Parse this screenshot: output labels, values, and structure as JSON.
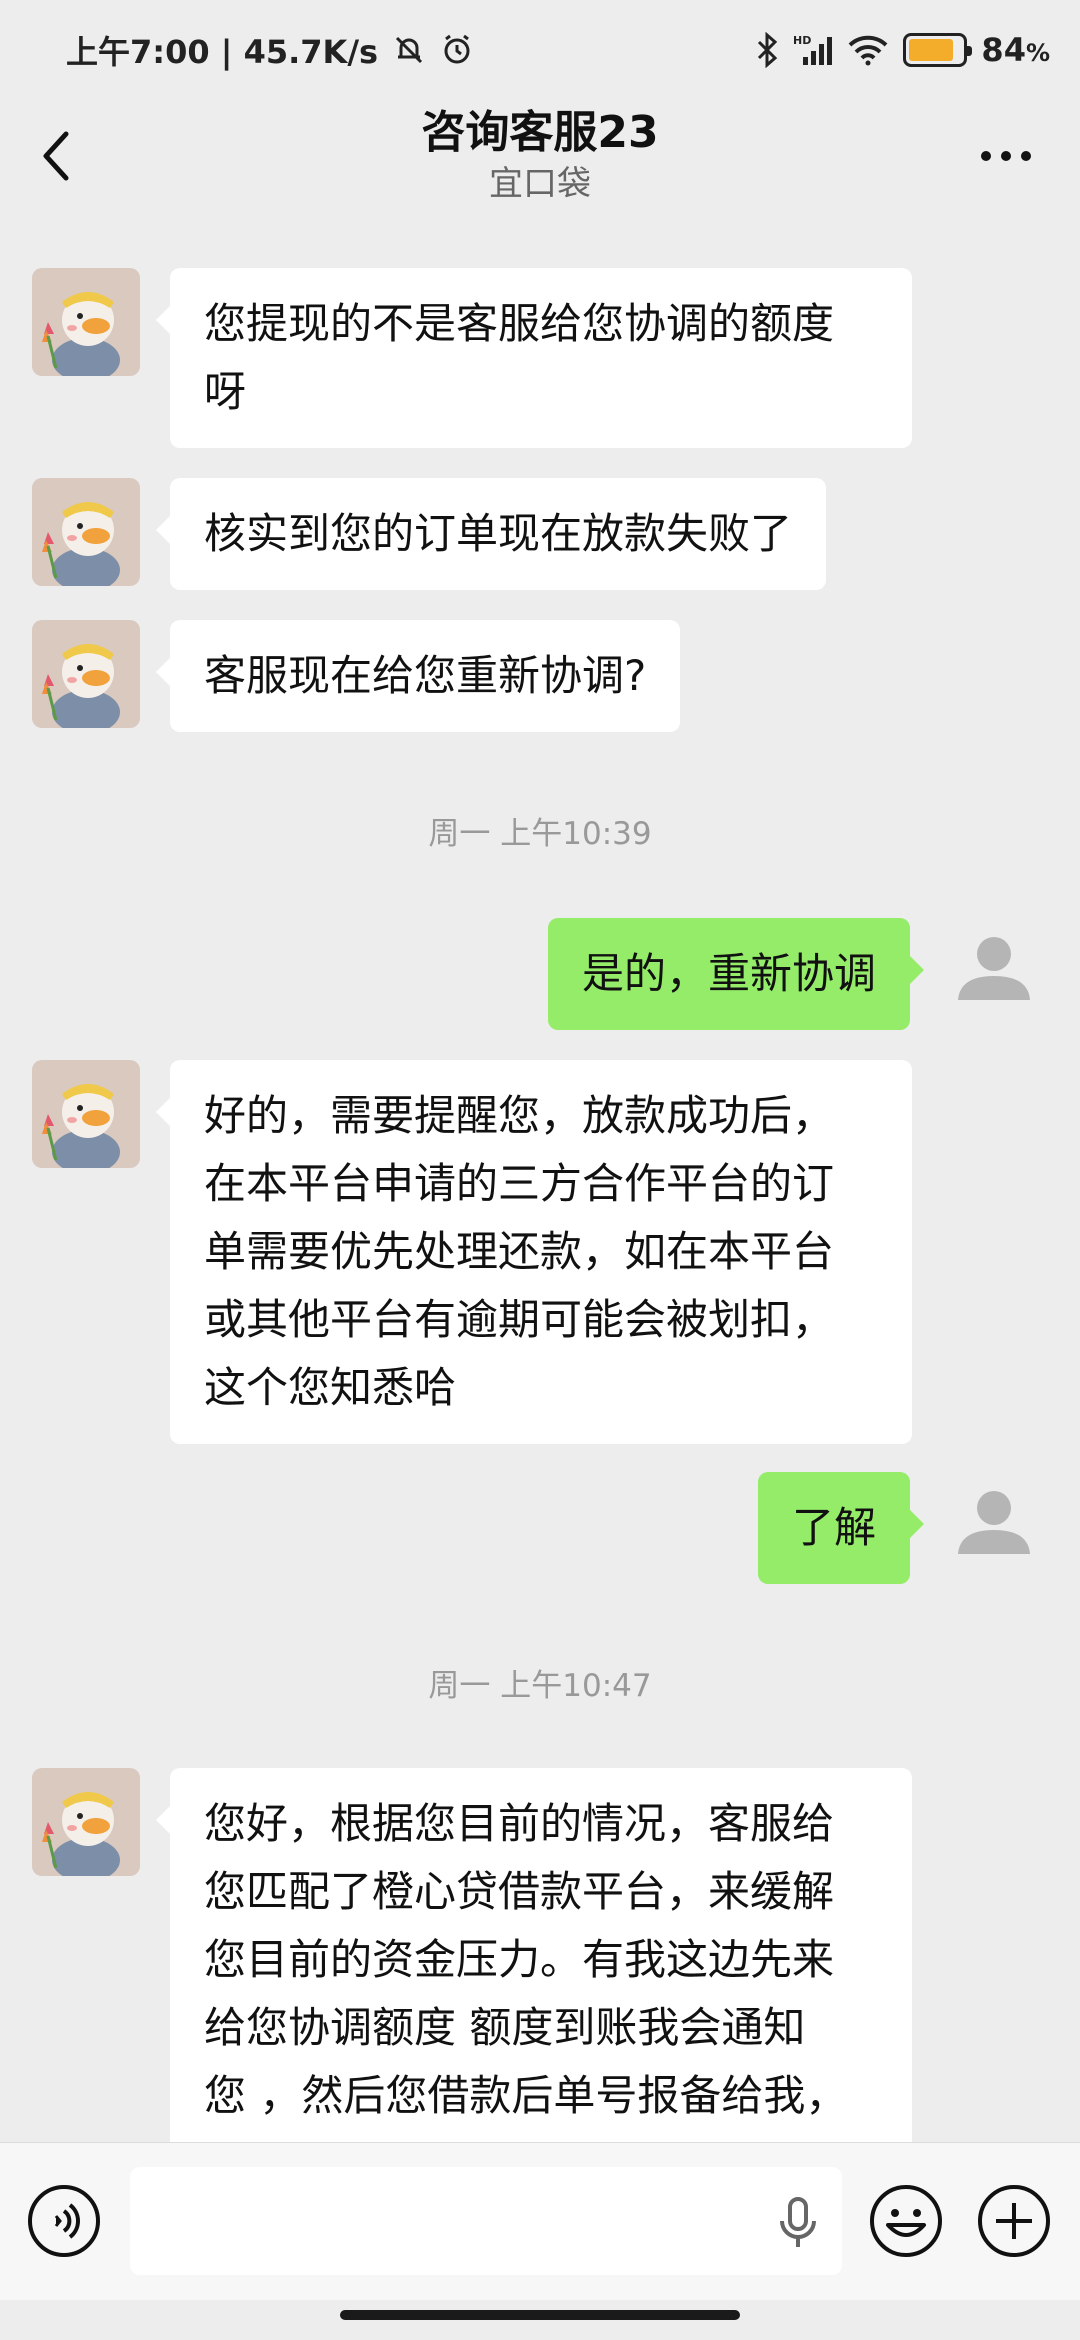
{
  "status_bar": {
    "time": "上午7:00 | 45.7K/s",
    "battery_percent": "84",
    "battery_unit": "%",
    "battery_level": 0.84,
    "battery_color": "#f3ad2a",
    "icons": [
      "bell-muted-icon",
      "alarm-icon",
      "bluetooth-icon",
      "signal-icon",
      "wifi-icon",
      "battery-icon"
    ]
  },
  "header": {
    "title": "咨询客服23",
    "subtitle": "宜口袋",
    "back_icon": "chevron-left-icon",
    "more_icon": "more-icon"
  },
  "messages": [
    {
      "side": "left",
      "text_lines": [
        "您提现的不是客服给您协调的额度",
        "呀"
      ]
    },
    {
      "side": "left",
      "text_lines": [
        "核实到您的订单现在放款失败了"
      ]
    },
    {
      "side": "left",
      "text_lines": [
        "客服现在给您重新协调?"
      ]
    },
    {
      "type": "time",
      "text": "周一 上午10:39"
    },
    {
      "side": "right",
      "text_lines": [
        "是的，重新协调"
      ]
    },
    {
      "side": "left",
      "text_lines": [
        "好的，需要提醒您，放款成功后，",
        "在本平台申请的三方合作平台的订",
        "单需要优先处理还款，如在本平台",
        "或其他平台有逾期可能会被划扣，",
        "这个您知悉哈"
      ]
    },
    {
      "side": "right",
      "text_lines": [
        "了解"
      ]
    },
    {
      "type": "time",
      "text": "周一 上午10:47"
    },
    {
      "side": "left",
      "text_lines": [
        "您好，根据您目前的情况，客服给",
        "您匹配了橙心贷借款平台，来缓解",
        "您目前的资金压力。有我这边先来",
        "给您协调额度 额度到账我会通知",
        "您 ，然后您借款后单号报备给我，"
      ]
    }
  ],
  "input_bar": {
    "voice_icon": "voice-icon",
    "mic_icon": "microphone-icon",
    "emoji_icon": "emoji-icon",
    "plus_icon": "plus-icon"
  },
  "colors": {
    "background": "#ededed",
    "self_bubble": "#95ec69",
    "other_bubble": "#ffffff"
  }
}
